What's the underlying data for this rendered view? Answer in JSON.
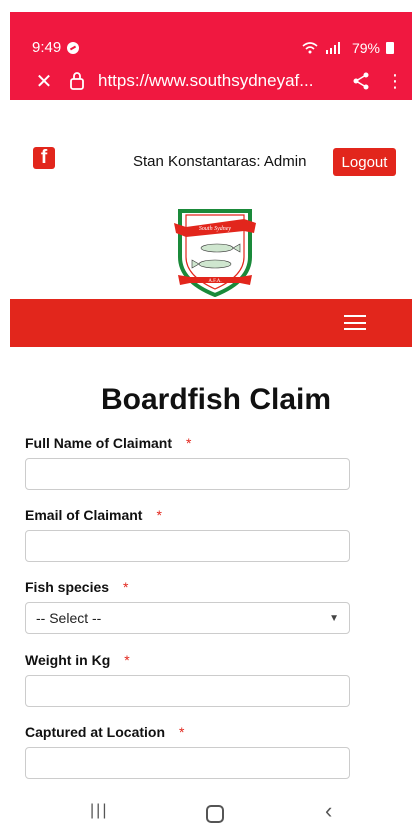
{
  "status_bar": {
    "time": "9:49",
    "battery": "79%"
  },
  "browser": {
    "url": "https://www.southsydneyaf..."
  },
  "header": {
    "user_text": "Stan Konstantaras: Admin",
    "logout_label": "Logout"
  },
  "logo": {
    "text_top": "South Sydney",
    "text_bottom": "A.F.A."
  },
  "page_title": "Boardfish Claim",
  "form": {
    "full_name_label": "Full Name of Claimant",
    "email_label": "Email of Claimant",
    "species_label": "Fish species",
    "species_value": "-- Select --",
    "weight_label": "Weight in Kg",
    "location_label": "Captured at Location",
    "required_mark": "*"
  },
  "colors": {
    "browser_bar": "#f01840",
    "brand_red": "#e2261c"
  }
}
